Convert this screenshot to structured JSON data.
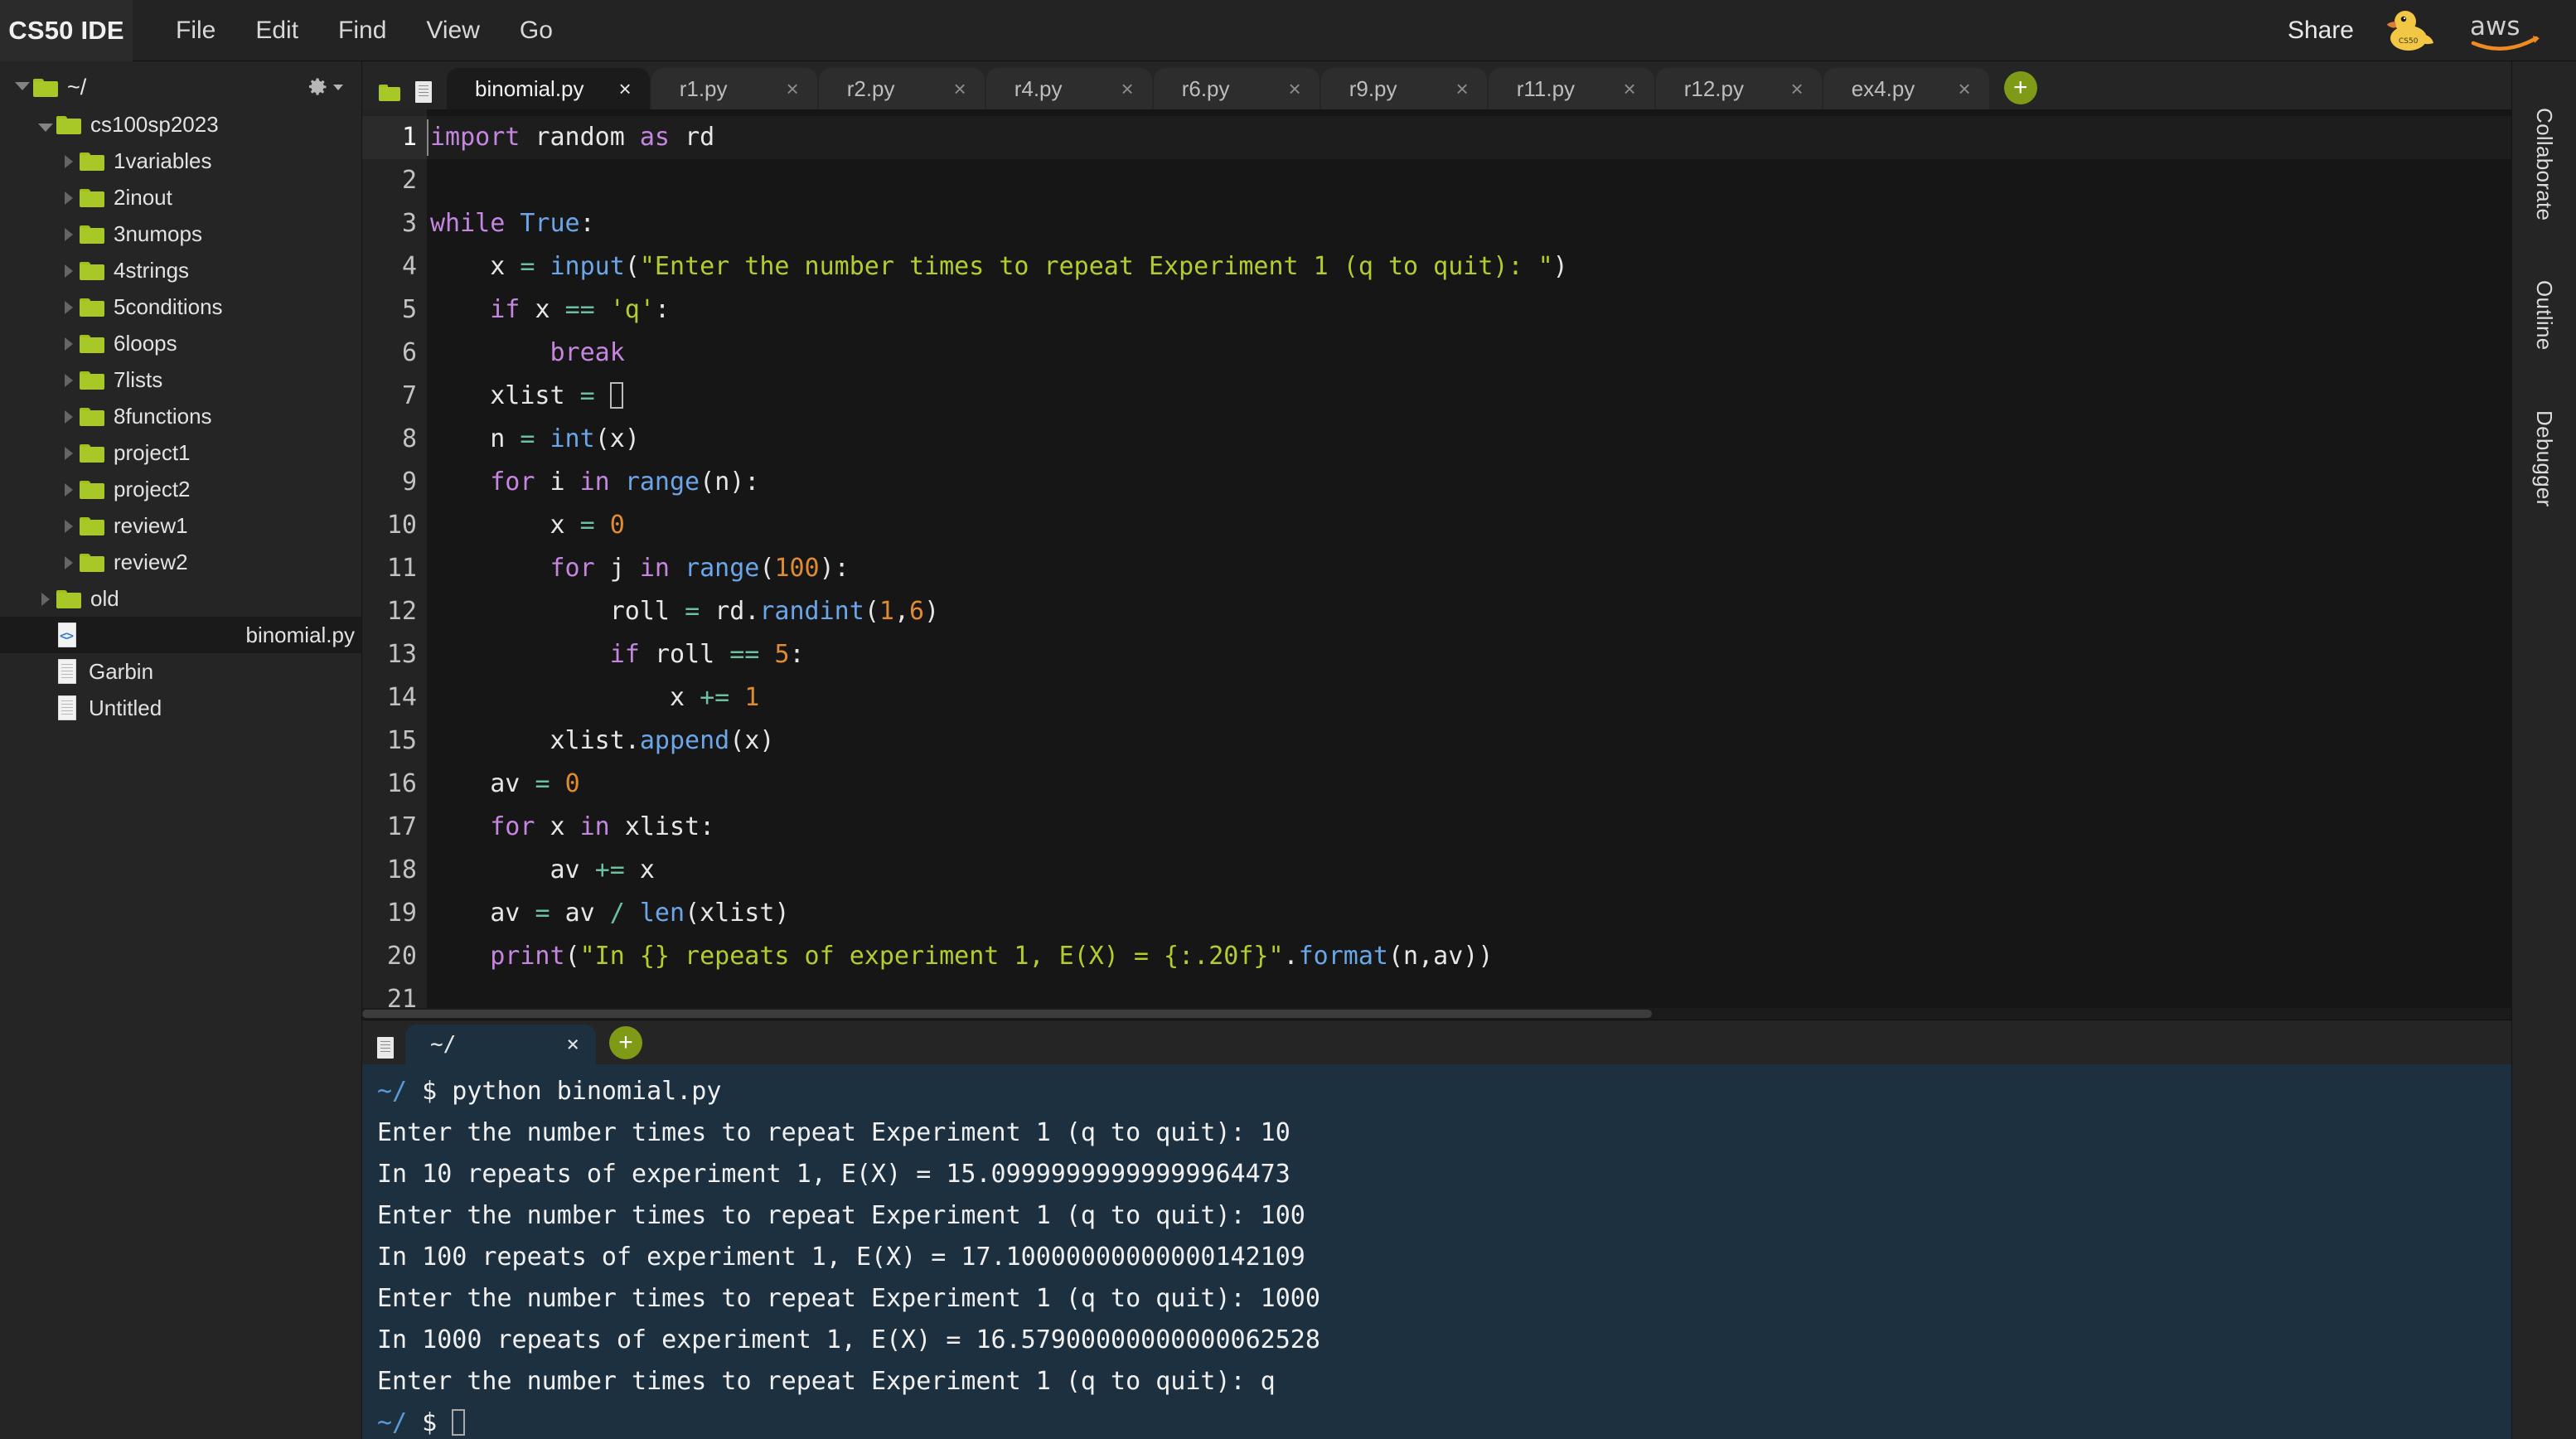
{
  "menubar": {
    "brand": "CS50 IDE",
    "items": [
      "File",
      "Edit",
      "Find",
      "View",
      "Go"
    ],
    "share_label": "Share",
    "duck_label": "CS50",
    "aws_label": "aws"
  },
  "filetree": {
    "root_label": "~/",
    "gear_icon": "gear-icon",
    "nodes": [
      {
        "label": "cs100sp2023",
        "type": "folder",
        "depth": 1,
        "expanded": true
      },
      {
        "label": "1variables",
        "type": "folder",
        "depth": 2,
        "expanded": false
      },
      {
        "label": "2inout",
        "type": "folder",
        "depth": 2,
        "expanded": false
      },
      {
        "label": "3numops",
        "type": "folder",
        "depth": 2,
        "expanded": false
      },
      {
        "label": "4strings",
        "type": "folder",
        "depth": 2,
        "expanded": false
      },
      {
        "label": "5conditions",
        "type": "folder",
        "depth": 2,
        "expanded": false
      },
      {
        "label": "6loops",
        "type": "folder",
        "depth": 2,
        "expanded": false
      },
      {
        "label": "7lists",
        "type": "folder",
        "depth": 2,
        "expanded": false
      },
      {
        "label": "8functions",
        "type": "folder",
        "depth": 2,
        "expanded": false
      },
      {
        "label": "project1",
        "type": "folder",
        "depth": 2,
        "expanded": false
      },
      {
        "label": "project2",
        "type": "folder",
        "depth": 2,
        "expanded": false
      },
      {
        "label": "review1",
        "type": "folder",
        "depth": 2,
        "expanded": false
      },
      {
        "label": "review2",
        "type": "folder",
        "depth": 2,
        "expanded": false
      },
      {
        "label": "old",
        "type": "folder",
        "depth": 1,
        "expanded": false
      },
      {
        "label": "binomial.py",
        "type": "codefile",
        "depth": 1,
        "selected": true
      },
      {
        "label": "Garbin",
        "type": "file",
        "depth": 1
      },
      {
        "label": "Untitled",
        "type": "file",
        "depth": 1
      }
    ]
  },
  "editor": {
    "tabs": [
      {
        "label": "binomial.py",
        "active": true,
        "close": "×"
      },
      {
        "label": "r1.py",
        "active": false,
        "close": "×"
      },
      {
        "label": "r2.py",
        "active": false,
        "close": "×"
      },
      {
        "label": "r4.py",
        "active": false,
        "close": "×"
      },
      {
        "label": "r6.py",
        "active": false,
        "close": "×"
      },
      {
        "label": "r9.py",
        "active": false,
        "close": "×"
      },
      {
        "label": "r11.py",
        "active": false,
        "close": "×"
      },
      {
        "label": "r12.py",
        "active": false,
        "close": "×"
      },
      {
        "label": "ex4.py",
        "active": false,
        "close": "×"
      }
    ],
    "add_tab_label": "+",
    "line_numbers": [
      "1",
      "2",
      "3",
      "4",
      "5",
      "6",
      "7",
      "8",
      "9",
      "10",
      "11",
      "12",
      "13",
      "14",
      "15",
      "16",
      "17",
      "18",
      "19",
      "20",
      "21"
    ],
    "code_lines": [
      "import random as rd",
      "",
      "while True:",
      "    x = input(\"Enter the number times to repeat Experiment 1 (q to quit): \")",
      "    if x == 'q':",
      "        break",
      "    xlist = []",
      "    n = int(x)",
      "    for i in range(n):",
      "        x = 0",
      "        for j in range(100):",
      "            roll = rd.randint(1,6)",
      "            if roll == 5:",
      "                x += 1",
      "        xlist.append(x)",
      "    av = 0",
      "    for x in xlist:",
      "        av += x",
      "    av = av / len(xlist)",
      "    print(\"In {} repeats of experiment 1, E(X) = {:.20f}\".format(n,av))",
      ""
    ],
    "language": "python",
    "cursor_line": 1
  },
  "terminal": {
    "tabs": [
      {
        "label": "~/",
        "active": true,
        "close": "×"
      }
    ],
    "add_tab_label": "+",
    "prompt_path": "~/",
    "prompt_symbol": "$",
    "lines": [
      {
        "type": "prompt",
        "path": "~/",
        "symbol": "$",
        "text": " python binomial.py"
      },
      {
        "type": "output",
        "text": "Enter the number times to repeat Experiment 1 (q to quit): 10"
      },
      {
        "type": "output",
        "text": "In 10 repeats of experiment 1, E(X) = 15.09999999999999964473"
      },
      {
        "type": "output",
        "text": "Enter the number times to repeat Experiment 1 (q to quit): 100"
      },
      {
        "type": "output",
        "text": "In 100 repeats of experiment 1, E(X) = 17.10000000000000142109"
      },
      {
        "type": "output",
        "text": "Enter the number times to repeat Experiment 1 (q to quit): 1000"
      },
      {
        "type": "output",
        "text": "In 1000 repeats of experiment 1, E(X) = 16.57900000000000062528"
      },
      {
        "type": "output",
        "text": "Enter the number times to repeat Experiment 1 (q to quit): q"
      },
      {
        "type": "prompt_cursor",
        "path": "~/",
        "symbol": "$",
        "text": ""
      }
    ]
  },
  "rightrail": {
    "items": [
      "Collaborate",
      "Outline",
      "Debugger"
    ]
  },
  "colors": {
    "accent_green": "#a8c827",
    "keyword": "#c586e0",
    "builtin": "#6aa6e8",
    "string": "#b5cc2e",
    "number": "#e08b30",
    "operator": "#6fc0a0",
    "terminal_bg": "#1d303f",
    "editor_bg": "#161616",
    "panel_bg": "#252525"
  }
}
